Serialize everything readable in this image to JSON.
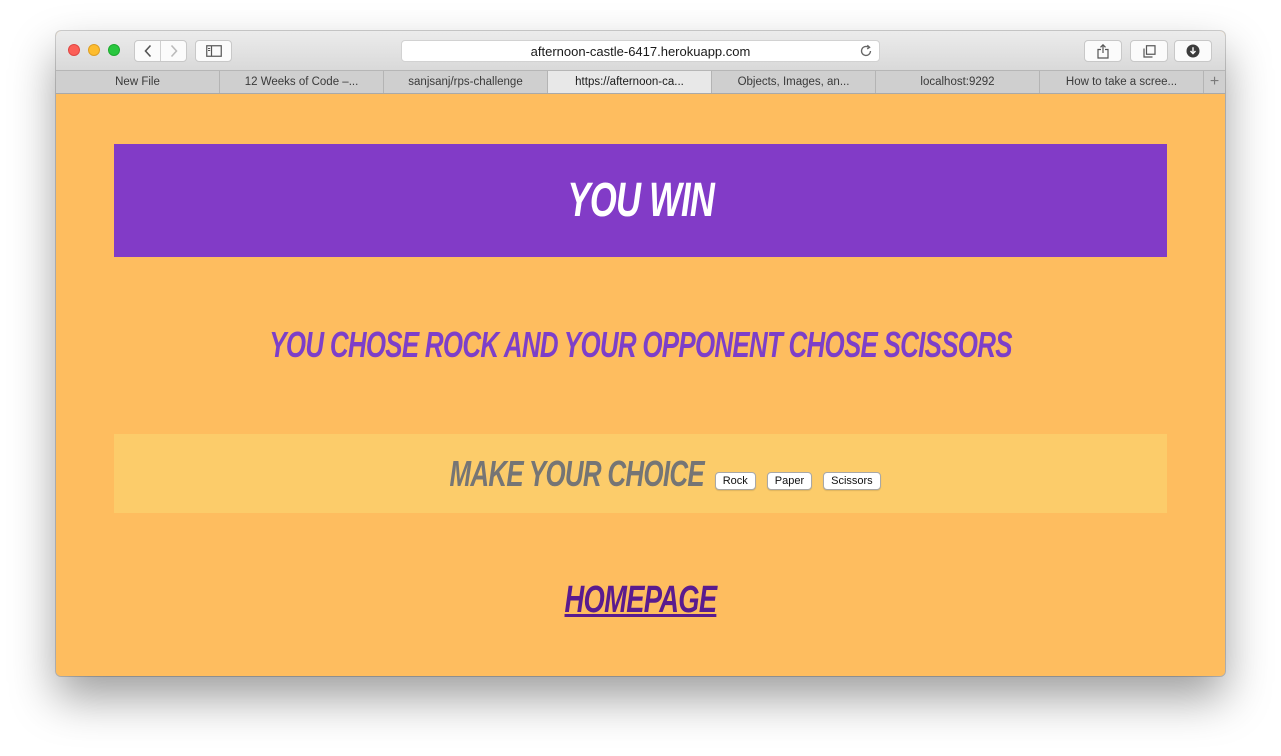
{
  "browser": {
    "url": "afternoon-castle-6417.herokuapp.com",
    "tabs": [
      {
        "label": "New File",
        "active": false
      },
      {
        "label": "12 Weeks of Code –...",
        "active": false
      },
      {
        "label": "sanjsanj/rps-challenge",
        "active": false
      },
      {
        "label": "https://afternoon-ca...",
        "active": true
      },
      {
        "label": "Objects, Images, an...",
        "active": false
      },
      {
        "label": "localhost:9292",
        "active": false
      },
      {
        "label": "How to take a scree...",
        "active": false
      }
    ],
    "new_tab_label": "+"
  },
  "page": {
    "banner_title": "You Win",
    "result_text": "You chose rock and your opponent chose scissors",
    "choice_label": "Make your choice",
    "choices": [
      "Rock",
      "Paper",
      "Scissors"
    ],
    "homepage_link": "Homepage"
  },
  "colors": {
    "background": "#febd5f",
    "banner": "#823bc7",
    "result_text": "#7d3fc9",
    "choice_bar": "#fccc6a",
    "choice_label": "#757575",
    "link": "#5a1b8e"
  }
}
